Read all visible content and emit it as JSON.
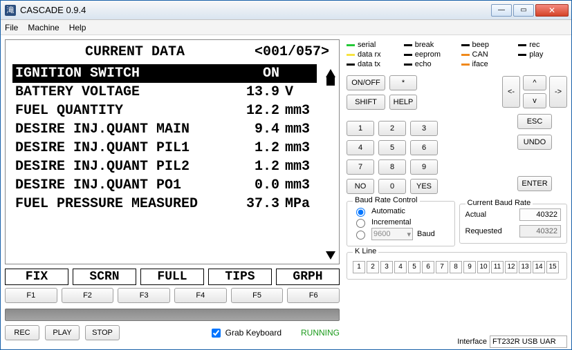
{
  "window": {
    "title": "CASCADE 0.9.4"
  },
  "menu": {
    "file": "File",
    "machine": "Machine",
    "help": "Help"
  },
  "screen": {
    "title": "CURRENT DATA",
    "page": "<001/057>",
    "rows": [
      {
        "label": "IGNITION SWITCH",
        "value": "ON",
        "unit": "",
        "inv": true
      },
      {
        "label": "BATTERY VOLTAGE",
        "value": "13.9",
        "unit": "V",
        "inv": false
      },
      {
        "label": "FUEL QUANTITY",
        "value": "12.2",
        "unit": "mm3",
        "inv": false
      },
      {
        "label": "DESIRE INJ.QUANT MAIN",
        "value": "9.4",
        "unit": "mm3",
        "inv": false
      },
      {
        "label": "DESIRE INJ.QUANT PIL1",
        "value": "1.2",
        "unit": "mm3",
        "inv": false
      },
      {
        "label": "DESIRE INJ.QUANT PIL2",
        "value": "1.2",
        "unit": "mm3",
        "inv": false
      },
      {
        "label": "DESIRE INJ.QUANT PO1",
        "value": "0.0",
        "unit": "mm3",
        "inv": false
      },
      {
        "label": "FUEL PRESSURE MEASURED",
        "value": "37.3",
        "unit": "MPa",
        "inv": false
      }
    ]
  },
  "softkeys": {
    "k1": "FIX",
    "k2": "SCRN",
    "k3": "FULL",
    "k4": "TIPS",
    "k5": "GRPH"
  },
  "fkeys": {
    "f1": "F1",
    "f2": "F2",
    "f3": "F3",
    "f4": "F4",
    "f5": "F5",
    "f6": "F6"
  },
  "bottom": {
    "rec": "REC",
    "play": "PLAY",
    "stop": "STOP",
    "grab": "Grab Keyboard",
    "grab_checked": true,
    "status": "RUNNING"
  },
  "status": {
    "serial": {
      "label": "serial",
      "color": "#23c937"
    },
    "break": {
      "label": "break",
      "color": "#000000"
    },
    "beep": {
      "label": "beep",
      "color": "#000000"
    },
    "rec": {
      "label": "rec",
      "color": "#000000"
    },
    "datarx": {
      "label": "data rx",
      "color": "#f7e341"
    },
    "eeprom": {
      "label": "eeprom",
      "color": "#000000"
    },
    "can": {
      "label": "CAN",
      "color": "#f0891b"
    },
    "play": {
      "label": "play",
      "color": "#000000"
    },
    "datatx": {
      "label": "data tx",
      "color": "#000000"
    },
    "echo": {
      "label": "echo",
      "color": "#000000"
    },
    "iface": {
      "label": "iface",
      "color": "#f0891b"
    }
  },
  "buttons": {
    "onoff": "ON/OFF",
    "star": "*",
    "shift": "SHIFT",
    "help": "HELP",
    "no": "NO",
    "yes": "YES",
    "esc": "ESC",
    "undo": "UNDO",
    "enter": "ENTER",
    "lt": "<-",
    "rt": "->",
    "up": "^",
    "dn": "v",
    "n1": "1",
    "n2": "2",
    "n3": "3",
    "n4": "4",
    "n5": "5",
    "n6": "6",
    "n7": "7",
    "n8": "8",
    "n9": "9",
    "n0": "0"
  },
  "baud": {
    "group_label": "Baud Rate Control",
    "auto": "Automatic",
    "incr": "Incremental",
    "fixed_value": "9600",
    "fixed_suffix": "Baud"
  },
  "curbaud": {
    "group_label": "Current Baud Rate",
    "actual_label": "Actual",
    "actual_value": "40322",
    "req_label": "Requested",
    "req_value": "40322"
  },
  "kline": {
    "label": "K Line",
    "cells": [
      "1",
      "2",
      "3",
      "4",
      "5",
      "6",
      "7",
      "8",
      "9",
      "10",
      "11",
      "12",
      "13",
      "14",
      "15"
    ]
  },
  "footer": {
    "iface_label": "Interface",
    "iface_value": "FT232R USB UAR"
  }
}
